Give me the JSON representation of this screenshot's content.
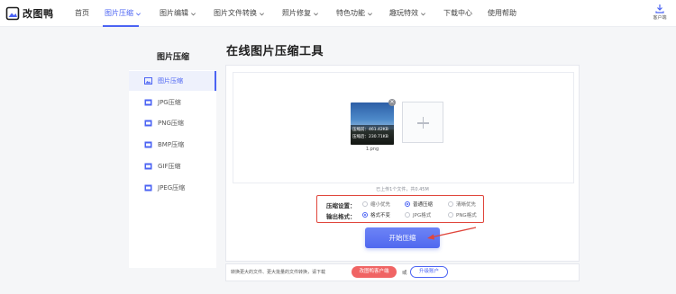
{
  "app": {
    "name": "改图鸭"
  },
  "nav": {
    "items": [
      {
        "label": "首页",
        "has_caret": false
      },
      {
        "label": "图片压缩",
        "has_caret": true,
        "active": true
      },
      {
        "label": "图片编辑",
        "has_caret": true
      },
      {
        "label": "图片文件转换",
        "has_caret": true
      },
      {
        "label": "照片修复",
        "has_caret": true
      },
      {
        "label": "特色功能",
        "has_caret": true
      },
      {
        "label": "趣玩特效",
        "has_caret": true
      },
      {
        "label": "下载中心",
        "has_caret": false
      },
      {
        "label": "使用帮助",
        "has_caret": false
      }
    ],
    "client_label": "客户端"
  },
  "sidebar": {
    "title": "图片压缩",
    "items": [
      {
        "label": "图片压缩",
        "icon": "image-icon",
        "active": true
      },
      {
        "label": "JPG压缩",
        "icon": "jpg-file-icon"
      },
      {
        "label": "PNG压缩",
        "icon": "png-file-icon"
      },
      {
        "label": "BMP压缩",
        "icon": "bmp-file-icon"
      },
      {
        "label": "GIF压缩",
        "icon": "gif-file-icon"
      },
      {
        "label": "JPEG压缩",
        "icon": "jpeg-file-icon"
      }
    ]
  },
  "main": {
    "title": "在线图片压缩工具",
    "file": {
      "before_label": "压缩前：461.42KB",
      "after_label": "压缩后：230.71KB",
      "name": "1.png"
    },
    "upload_note": "已上传1个文件，共0.45M",
    "settings": {
      "compress_label": "压缩设置：",
      "compress_options": [
        "缩小优先",
        "普通压缩",
        "清晰优先"
      ],
      "compress_selected": "普通压缩",
      "format_label": "输出格式：",
      "format_options": [
        "格式不变",
        "JPG格式",
        "PNG格式"
      ],
      "format_selected": "格式不变"
    },
    "start_button": "开始压缩",
    "footer": {
      "text": "转换更大的文件、更大批量的文件转换，请下载",
      "client_button": "改图鸭客户端",
      "or": "或",
      "upgrade_button": "升级账户"
    }
  },
  "colors": {
    "accent": "#4b63f3",
    "highlight_red": "#e0463c",
    "client_button": "#f06464"
  }
}
